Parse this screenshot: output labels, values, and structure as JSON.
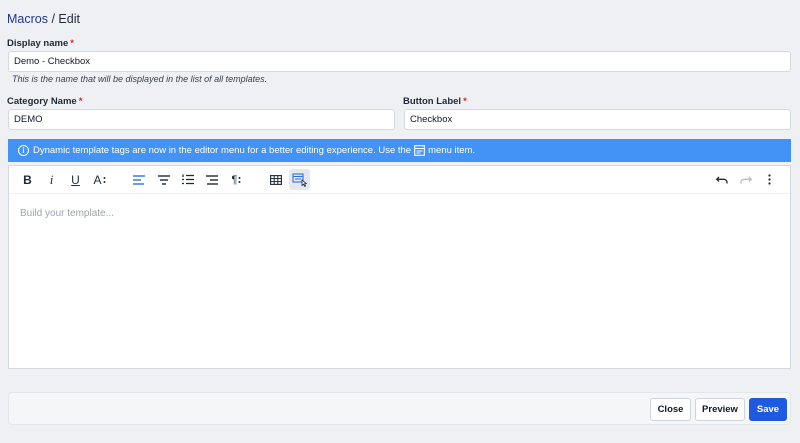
{
  "breadcrumb": {
    "parent": "Macros",
    "separator": " / ",
    "current": "Edit"
  },
  "display_name": {
    "label": "Display name",
    "required_mark": "*",
    "value": "Demo - Checkbox",
    "help": "This is the name that will be displayed in the list of all templates."
  },
  "category_name": {
    "label": "Category Name",
    "required_mark": "*",
    "value": "DEMO"
  },
  "button_label": {
    "label": "Button Label",
    "required_mark": "*",
    "value": "Checkbox"
  },
  "banner": {
    "text_before": "Dynamic template tags are now in the editor menu for a better editing experience. Use the",
    "text_after": "menu item.",
    "color": "#4393f6"
  },
  "toolbar": {
    "bold": "B",
    "italic": "i",
    "underline": "U",
    "font_size": "A",
    "icons": [
      "bold-icon",
      "italic-icon",
      "underline-icon",
      "font-size-icon",
      "align-left-icon",
      "align-center-icon",
      "ordered-list-icon",
      "align-right-icon",
      "paragraph-icon",
      "table-icon",
      "template-tags-icon",
      "undo-icon",
      "redo-icon",
      "more-options-icon"
    ]
  },
  "editor": {
    "placeholder": "Build your template..."
  },
  "footer": {
    "close_label": "Close",
    "preview_label": "Preview",
    "save_label": "Save",
    "primary_color": "#1d5ae0"
  }
}
